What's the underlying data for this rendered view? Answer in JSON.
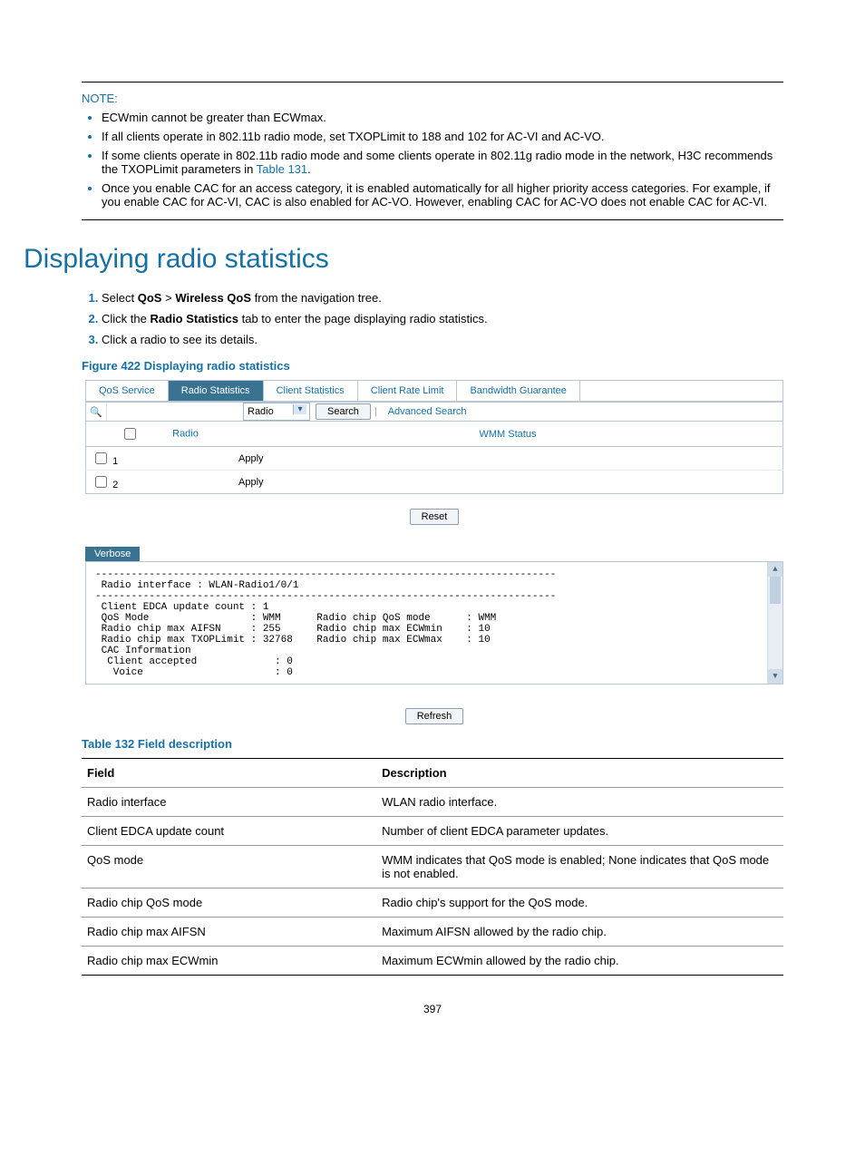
{
  "note": {
    "heading": "NOTE:",
    "items": [
      "ECWmin cannot be greater than ECWmax.",
      "If all clients operate in 802.11b radio mode, set TXOPLimit to 188 and 102 for AC-VI and AC-VO.",
      "If some clients operate in 802.11b radio mode and some clients operate in 802.11g radio mode in the network, H3C recommends the TXOPLimit parameters in ",
      "Once you enable CAC for an access category, it is enabled automatically for all higher priority access categories. For example, if you enable CAC for AC-VI, CAC is also enabled for AC-VO. However, enabling CAC for AC-VO does not enable CAC for AC-VI."
    ],
    "table_link": "Table 131"
  },
  "section_title": "Displaying radio statistics",
  "steps": [
    {
      "pre": "Select ",
      "b1": "QoS",
      "mid": " > ",
      "b2": "Wireless QoS",
      "post": " from the navigation tree."
    },
    {
      "pre": "Click the ",
      "b1": "Radio Statistics",
      "post": " tab to enter the page displaying radio statistics."
    },
    {
      "pre": "Click a radio to see its details."
    }
  ],
  "figure_caption": "Figure 422 Displaying radio statistics",
  "fig": {
    "tabs": [
      "QoS Service",
      "Radio Statistics",
      "Client Statistics",
      "Client Rate Limit",
      "Bandwidth Guarantee"
    ],
    "active_tab": 1,
    "search_select": "Radio",
    "search_button": "Search",
    "advanced": "Advanced Search",
    "table": {
      "headers": [
        "Radio",
        "WMM Status"
      ],
      "rows": [
        {
          "radio": "1",
          "wmm": "Apply"
        },
        {
          "radio": "2",
          "wmm": "Apply"
        }
      ]
    },
    "reset": "Reset",
    "verbose_tab": "Verbose",
    "verbose_text": "-----------------------------------------------------------------------------\n Radio interface : WLAN-Radio1/0/1\n-----------------------------------------------------------------------------\n Client EDCA update count : 1\n QoS Mode                 : WMM      Radio chip QoS mode      : WMM\n Radio chip max AIFSN     : 255      Radio chip max ECWmin    : 10\n Radio chip max TXOPLimit : 32768    Radio chip max ECWmax    : 10\n CAC Information\n  Client accepted             : 0\n   Voice                      : 0",
    "refresh": "Refresh"
  },
  "table132": {
    "caption": "Table 132 Field description",
    "headers": [
      "Field",
      "Description"
    ],
    "rows": [
      [
        "Radio interface",
        "WLAN radio interface."
      ],
      [
        "Client EDCA update count",
        "Number of client EDCA parameter updates."
      ],
      [
        "QoS mode",
        "WMM indicates that QoS mode is enabled; None indicates that QoS mode is not enabled."
      ],
      [
        "Radio chip QoS mode",
        "Radio chip's support for the QoS mode."
      ],
      [
        "Radio chip max AIFSN",
        "Maximum AIFSN allowed by the radio chip."
      ],
      [
        "Radio chip max ECWmin",
        "Maximum ECWmin allowed by the radio chip."
      ]
    ]
  },
  "page_number": "397"
}
